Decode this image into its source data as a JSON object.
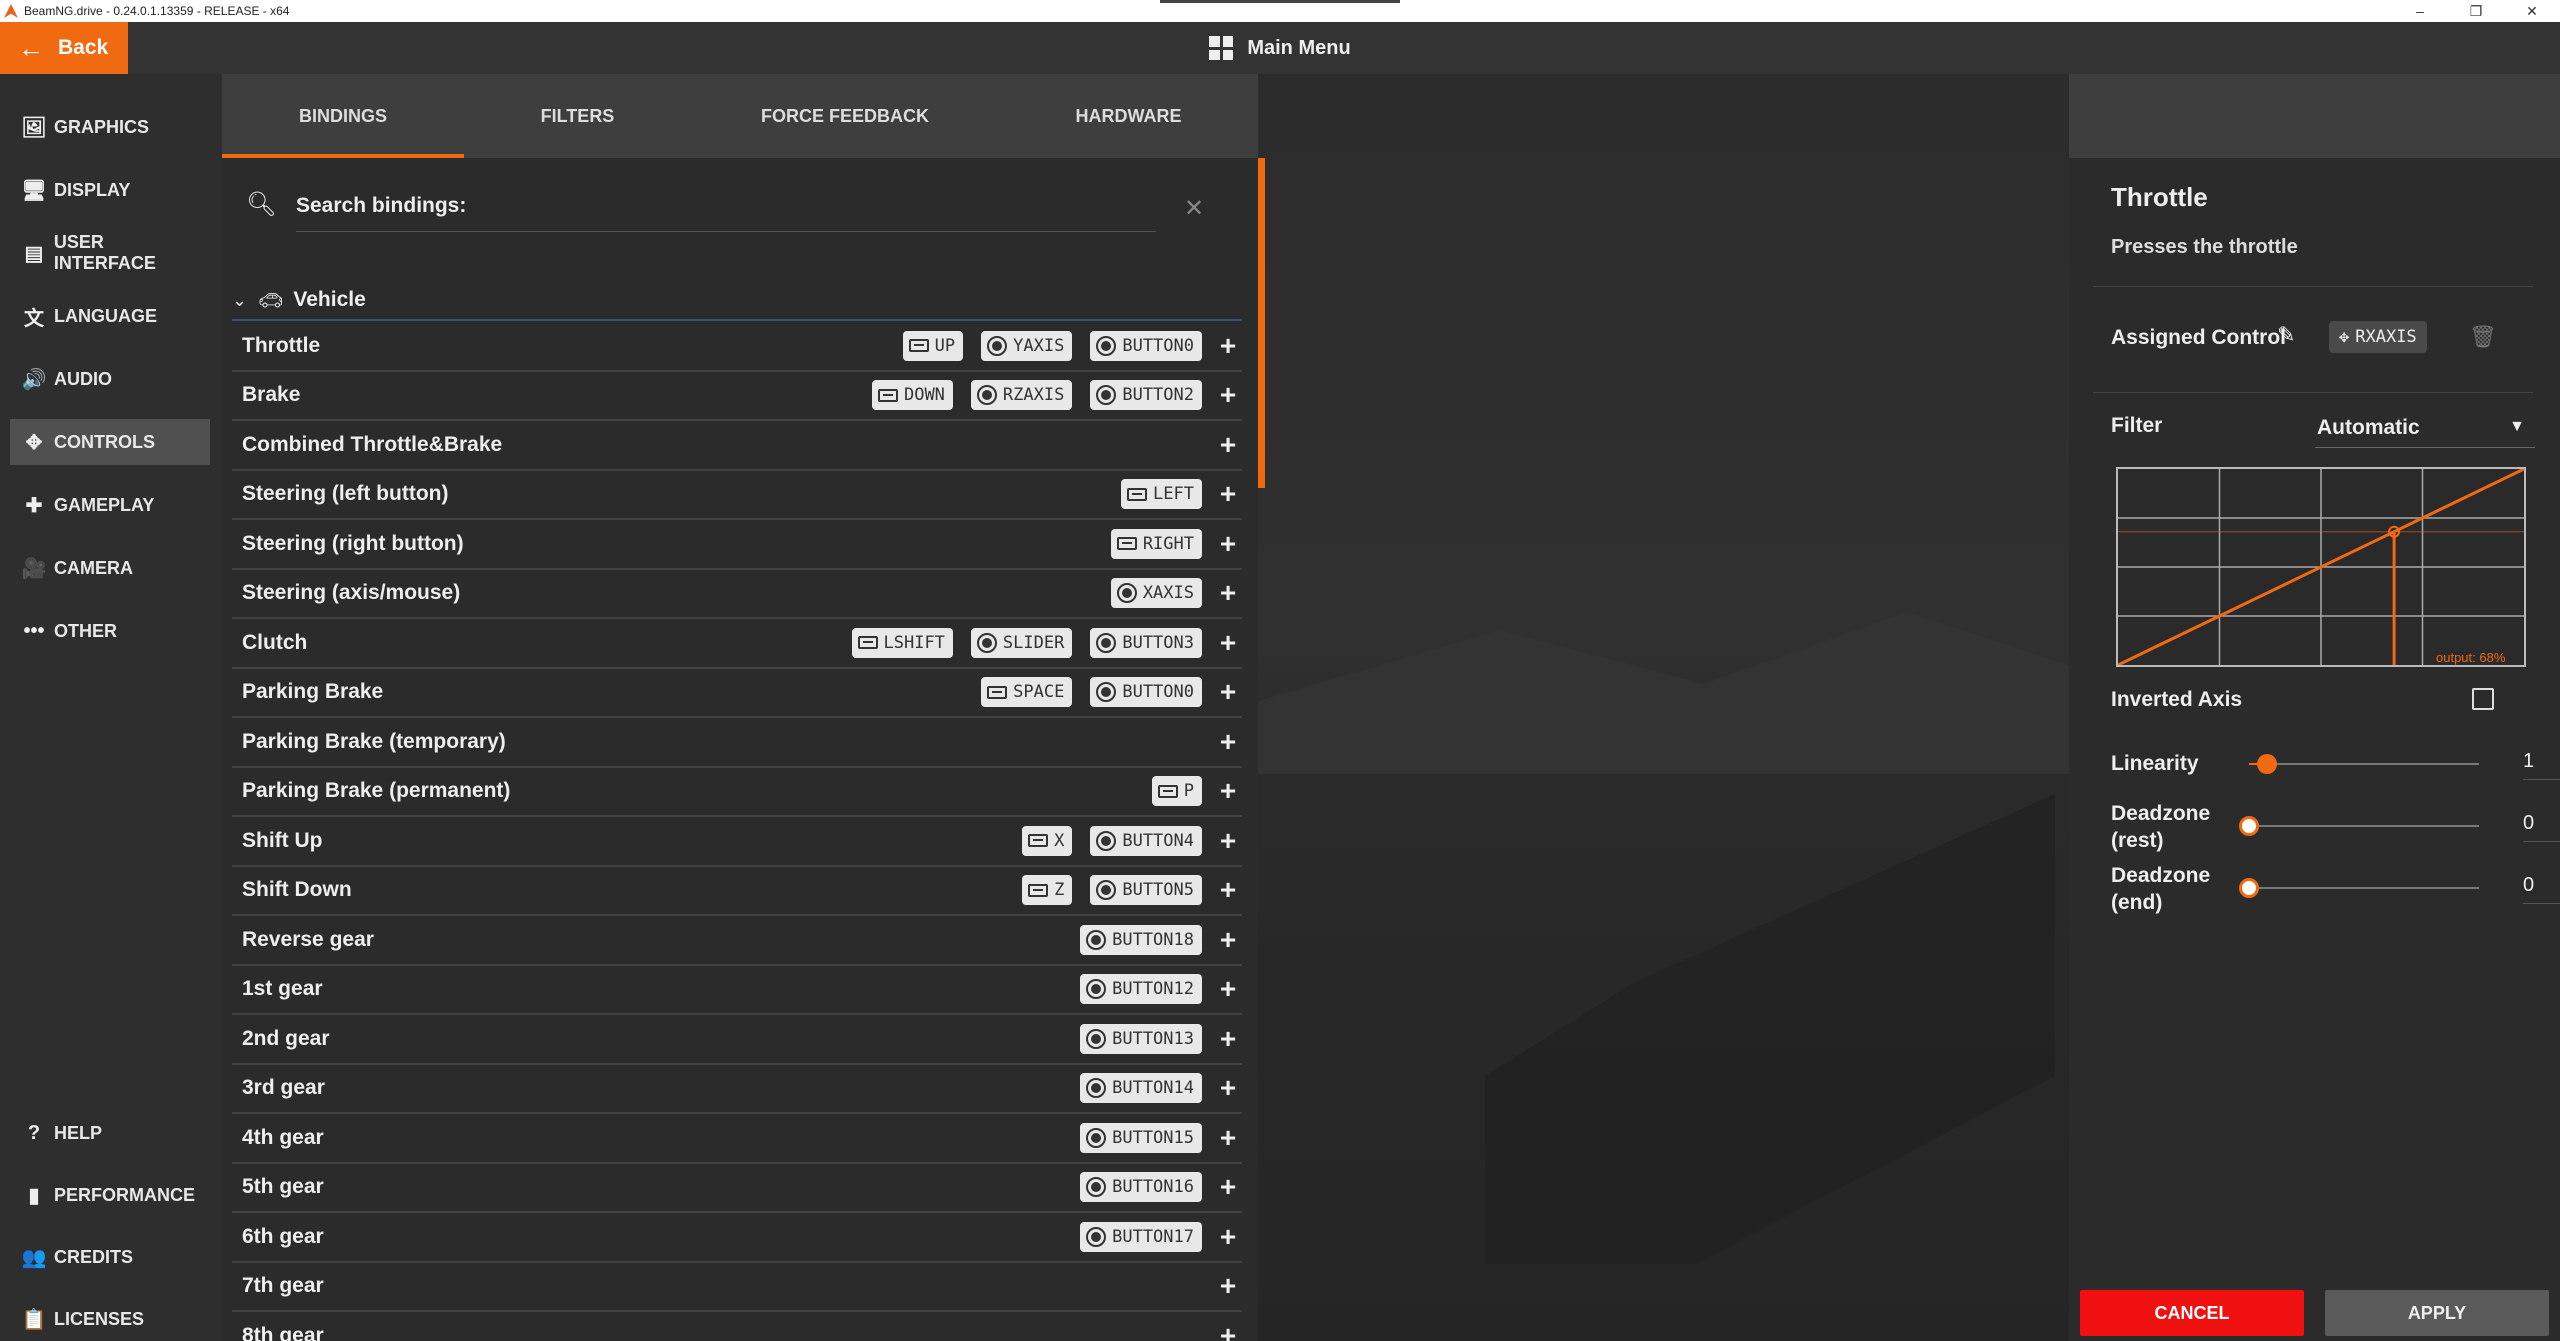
{
  "window": {
    "title": "BeamNG.drive - 0.24.0.1.13359 - RELEASE - x64",
    "controls": [
      "–",
      "❐",
      "✕"
    ]
  },
  "topbar": {
    "back_label": "Back",
    "title": "Main Menu"
  },
  "sidebar": {
    "items": [
      {
        "label": "GRAPHICS",
        "icon": "🖼",
        "name": "graphics"
      },
      {
        "label": "DISPLAY",
        "icon": "🖥",
        "name": "display"
      },
      {
        "label": "USER INTERFACE",
        "icon": "▤",
        "name": "user-interface"
      },
      {
        "label": "LANGUAGE",
        "icon": "文",
        "name": "language"
      },
      {
        "label": "AUDIO",
        "icon": "🔊",
        "name": "audio"
      },
      {
        "label": "CONTROLS",
        "icon": "✥",
        "name": "controls",
        "active": true
      },
      {
        "label": "GAMEPLAY",
        "icon": "✚",
        "name": "gameplay"
      },
      {
        "label": "CAMERA",
        "icon": "🎥",
        "name": "camera"
      },
      {
        "label": "OTHER",
        "icon": "•••",
        "name": "other"
      }
    ],
    "bottom_items": [
      {
        "label": "HELP",
        "icon": "?",
        "name": "help"
      },
      {
        "label": "PERFORMANCE",
        "icon": "▮",
        "name": "performance"
      },
      {
        "label": "CREDITS",
        "icon": "👥",
        "name": "credits"
      },
      {
        "label": "LICENSES",
        "icon": "📋",
        "name": "licenses"
      }
    ]
  },
  "tabs": [
    {
      "label": "BINDINGS",
      "active": true
    },
    {
      "label": "FILTERS"
    },
    {
      "label": "FORCE FEEDBACK"
    },
    {
      "label": "HARDWARE"
    }
  ],
  "search": {
    "label": "Search bindings:",
    "value": ""
  },
  "group": {
    "name": "Vehicle"
  },
  "bindings": [
    {
      "name": "Throttle",
      "chips": [
        {
          "type": "key",
          "label": "UP"
        },
        {
          "type": "joy",
          "label": "YAXIS"
        },
        {
          "type": "joy",
          "label": "BUTTON0"
        }
      ]
    },
    {
      "name": "Brake",
      "chips": [
        {
          "type": "key",
          "label": "DOWN"
        },
        {
          "type": "joy",
          "label": "RZAXIS"
        },
        {
          "type": "joy",
          "label": "BUTTON2"
        }
      ]
    },
    {
      "name": "Combined Throttle&Brake",
      "chips": []
    },
    {
      "name": "Steering (left button)",
      "chips": [
        {
          "type": "key",
          "label": "LEFT"
        }
      ]
    },
    {
      "name": "Steering (right button)",
      "chips": [
        {
          "type": "key",
          "label": "RIGHT"
        }
      ]
    },
    {
      "name": "Steering (axis/mouse)",
      "chips": [
        {
          "type": "joy",
          "label": "XAXIS"
        }
      ]
    },
    {
      "name": "Clutch",
      "chips": [
        {
          "type": "key",
          "label": "LSHIFT"
        },
        {
          "type": "joy",
          "label": "SLIDER"
        },
        {
          "type": "joy",
          "label": "BUTTON3"
        }
      ]
    },
    {
      "name": "Parking Brake",
      "chips": [
        {
          "type": "key",
          "label": "SPACE"
        },
        {
          "type": "joy",
          "label": "BUTTON0"
        }
      ]
    },
    {
      "name": "Parking Brake (temporary)",
      "chips": []
    },
    {
      "name": "Parking Brake (permanent)",
      "chips": [
        {
          "type": "key",
          "label": "P"
        }
      ]
    },
    {
      "name": "Shift Up",
      "chips": [
        {
          "type": "key",
          "label": "X"
        },
        {
          "type": "joy",
          "label": "BUTTON4"
        }
      ]
    },
    {
      "name": "Shift Down",
      "chips": [
        {
          "type": "key",
          "label": "Z"
        },
        {
          "type": "joy",
          "label": "BUTTON5"
        }
      ]
    },
    {
      "name": "Reverse gear",
      "chips": [
        {
          "type": "joy",
          "label": "BUTTON18"
        }
      ]
    },
    {
      "name": "1st gear",
      "chips": [
        {
          "type": "joy",
          "label": "BUTTON12"
        }
      ]
    },
    {
      "name": "2nd gear",
      "chips": [
        {
          "type": "joy",
          "label": "BUTTON13"
        }
      ]
    },
    {
      "name": "3rd gear",
      "chips": [
        {
          "type": "joy",
          "label": "BUTTON14"
        }
      ]
    },
    {
      "name": "4th gear",
      "chips": [
        {
          "type": "joy",
          "label": "BUTTON15"
        }
      ]
    },
    {
      "name": "5th gear",
      "chips": [
        {
          "type": "joy",
          "label": "BUTTON16"
        }
      ]
    },
    {
      "name": "6th gear",
      "chips": [
        {
          "type": "joy",
          "label": "BUTTON17"
        }
      ]
    },
    {
      "name": "7th gear",
      "chips": []
    },
    {
      "name": "8th gear",
      "chips": []
    }
  ],
  "detail": {
    "title": "Throttle",
    "description": "Presses the throttle",
    "assigned_label": "Assigned Control",
    "assigned_value": "RXAXIS",
    "filter_label": "Filter",
    "filter_value": "Automatic",
    "graph_output": "output: 68%",
    "graph_output_value": 0.68,
    "inverted_label": "Inverted Axis",
    "inverted_checked": false,
    "sliders": [
      {
        "label_lines": [
          "Linearity"
        ],
        "value": "1",
        "fraction": 0.08,
        "active": true
      },
      {
        "label_lines": [
          "Deadzone",
          "(rest)"
        ],
        "value": "0",
        "fraction": 0,
        "active": false
      },
      {
        "label_lines": [
          "Deadzone",
          "(end)"
        ],
        "value": "0",
        "fraction": 0,
        "active": false
      }
    ]
  },
  "footer": {
    "cancel_label": "CANCEL",
    "apply_label": "APPLY"
  },
  "colors": {
    "accent": "#f06a12",
    "cancel": "#f11010",
    "panel": "#2b2b2b"
  }
}
